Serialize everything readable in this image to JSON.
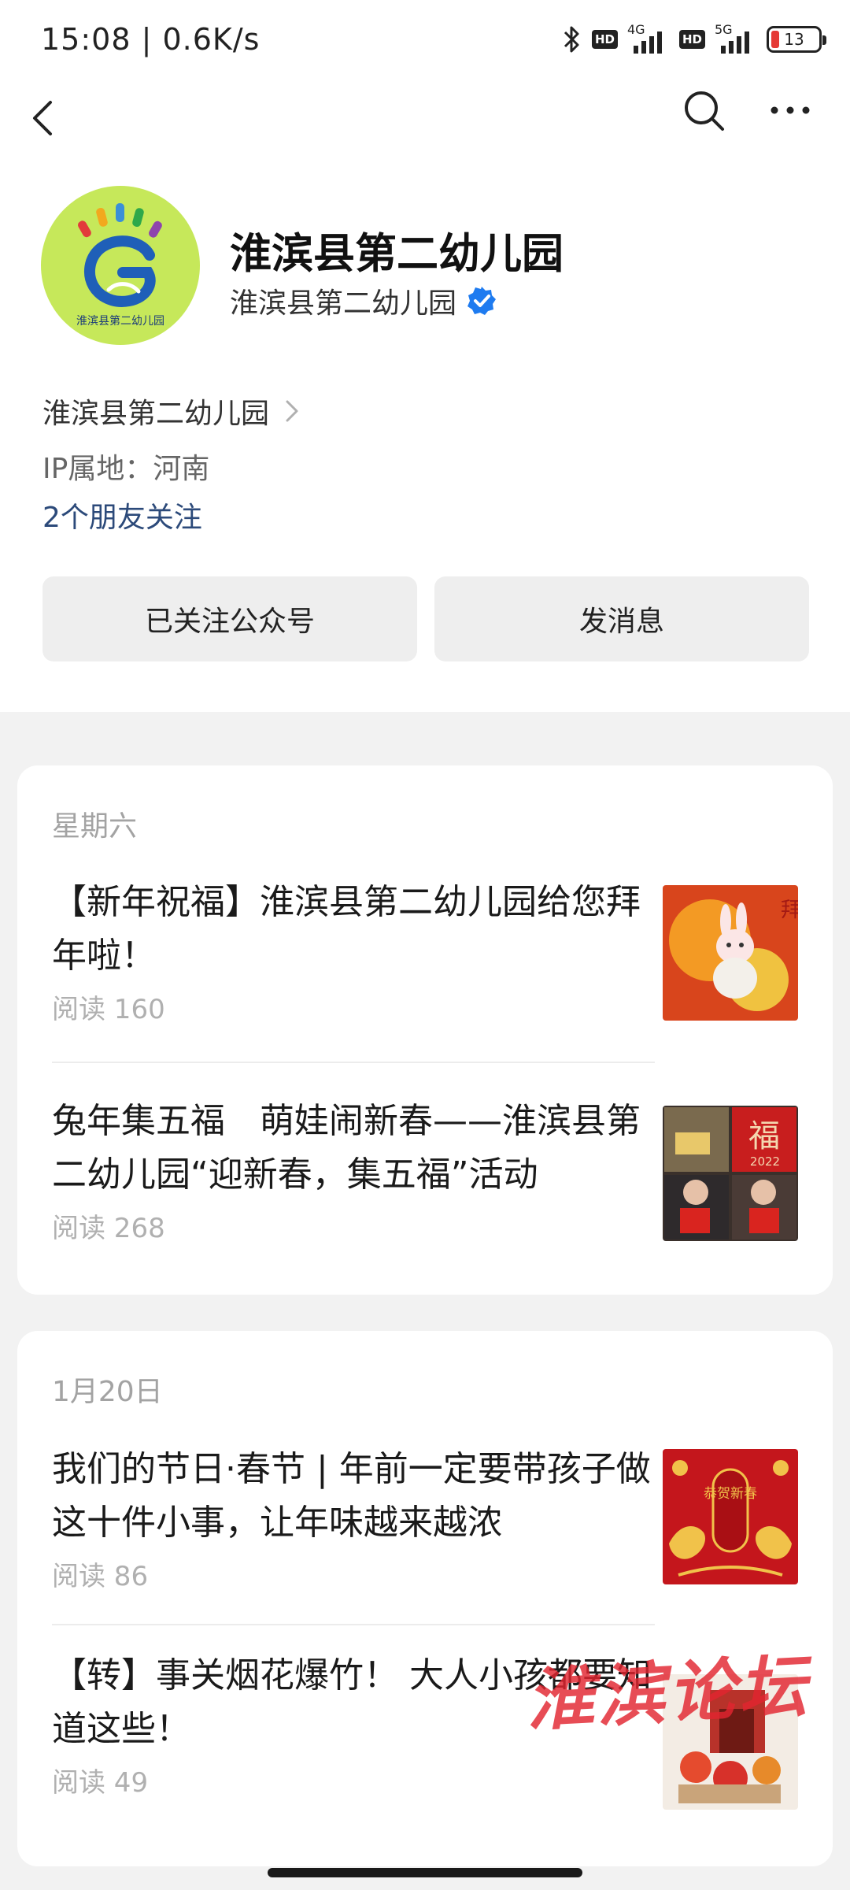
{
  "status_bar": {
    "time": "15:08 | 0.6K/s",
    "hd_badges": [
      "HD",
      "HD"
    ],
    "network_types": [
      "4G",
      "5G"
    ],
    "battery": "13",
    "colors": {
      "battery_low": "#e53935"
    }
  },
  "icons": {
    "back": "back-arrow-icon",
    "search": "search-icon",
    "more": "more-dots-icon",
    "verified": "verified-check-icon",
    "chevron": "chevron-right-icon"
  },
  "profile": {
    "name": "淮滨县第二幼儿园",
    "subtitle": "淮滨县第二幼儿园",
    "avatar_caption": "淮滨县第二幼儿园",
    "company": "淮滨县第二幼儿园",
    "ip": "IP属地：河南",
    "friends": "2个朋友关注",
    "colors": {
      "friends_link": "#2c4a7a",
      "verified": "#1e7bf0",
      "avatar_bg": "#c6e85a"
    }
  },
  "actions": {
    "follow": "已关注公众号",
    "message": "发消息"
  },
  "groups": [
    {
      "date": "星期六",
      "articles": [
        {
          "title": "【新年祝福】淮滨县第二幼儿园给您拜年啦！",
          "read": "阅读 160"
        },
        {
          "title": "兔年集五福　萌娃闹新春——淮滨县第二幼儿园“迎新春，集五福”活动",
          "read": "阅读 268"
        }
      ]
    },
    {
      "date": "1月20日",
      "articles": [
        {
          "title": "我们的节日·春节 | 年前一定要带孩子做这十件小事，让年味越来越浓",
          "read": "阅读 86"
        },
        {
          "title": "【转】事关烟花爆竹！ 大人小孩都要知道这些！",
          "read": "阅读 49"
        }
      ]
    }
  ],
  "thumbs": {
    "thumb1_text": "拜",
    "thumb2_text": "福",
    "thumb2_year": "2022",
    "thumb3_text": "恭贺新春"
  },
  "watermark": "淮滨论坛"
}
